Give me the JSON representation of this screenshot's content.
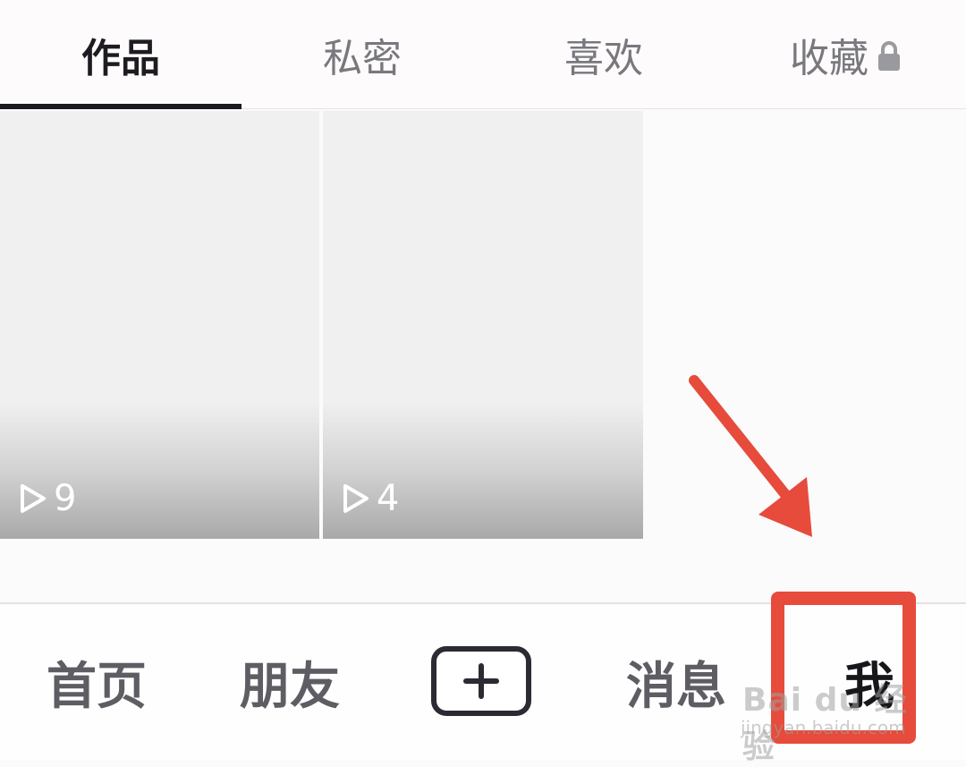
{
  "tabs": [
    {
      "label": "作品",
      "active": true
    },
    {
      "label": "私密",
      "active": false
    },
    {
      "label": "喜欢",
      "active": false
    },
    {
      "label": "收藏",
      "active": false,
      "icon": "lock-icon"
    }
  ],
  "videos": [
    {
      "play_count": "9",
      "icon": "play-icon"
    },
    {
      "play_count": "4",
      "icon": "play-icon"
    }
  ],
  "bottom_nav": {
    "items": [
      {
        "label": "首页",
        "active": false
      },
      {
        "label": "朋友",
        "active": false
      },
      {
        "label": "消息",
        "active": false
      },
      {
        "label": "我",
        "active": true
      }
    ],
    "create_icon": "plus-icon"
  },
  "annotation": {
    "arrow_color": "#e64b3c",
    "box_color": "#e64b3c"
  },
  "watermark": {
    "main": "Bai du 经验",
    "url": "jingyan.baidu.com"
  }
}
